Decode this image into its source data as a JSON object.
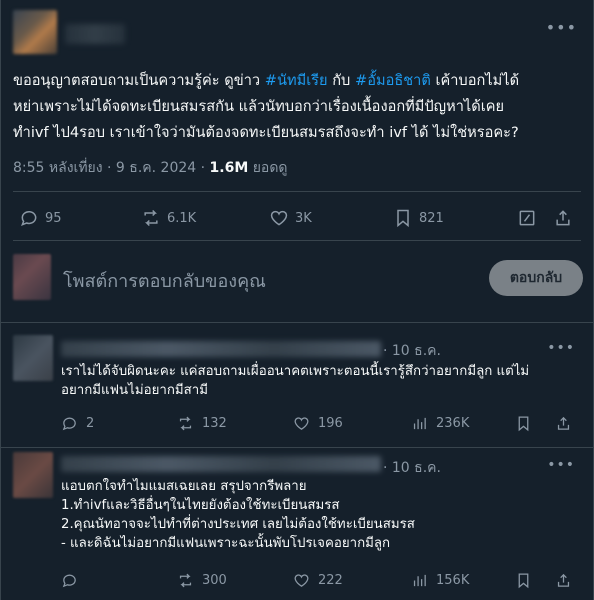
{
  "main_post": {
    "text_lines": [
      [
        "ขออนุญาตสอบถามเป็นความรู้ค่ะ ดูข่าว ",
        "#นัทมีเรีย",
        " กับ ",
        "#อั้มอธิชาติ",
        " เค้าบอกไม่ได้"
      ],
      [
        "หย่าเพราะไม่ได้จดทะเบียนสมรสกัน แล้วนัทบอกว่าเรื่องเนื้องอกที่มีปัญหาได้เคย"
      ],
      [
        "ทำivf ไป4รอบ เราเข้าใจว่ามันต้องจดทะเบียนสมรสถึงจะทำ ivf ได้ ไม่ใช่หรอคะ?"
      ]
    ],
    "time": "8:55 หลังเที่ยง · 9 ธ.ค. 2024 · ",
    "views": "1.6M",
    "views_label": " ยอดดู",
    "stats": {
      "replies": "95",
      "reposts": "6.1K",
      "likes": "3K",
      "bookmarks": "821"
    },
    "accent_color": "#1d9bf0"
  },
  "composer": {
    "placeholder": "โพสต์การตอบกลับของคุณ",
    "reply_button": "ตอบกลับ"
  },
  "replies": [
    {
      "date": "· 10 ธ.ค.",
      "text_lines": [
        "เราไม่ได้จับผิดนะคะ แค่สอบถามเผื่ออนาคตเพราะตอนนี้เรารู้สึกว่าอยากมีลูก แต่ไม่",
        "อยากมีแฟนไม่อยากมีสามี"
      ],
      "stats": {
        "replies": "2",
        "reposts": "132",
        "likes": "196",
        "views": "236K"
      }
    },
    {
      "date": "· 10 ธ.ค.",
      "text_lines": [
        "แอบตกใจทำไมแมสเฉยเลย สรุปจากรีพลาย",
        "1.ทำivfและวิธีอื่นๆในไทยยังต้องใช้ทะเบียนสมรส",
        "2.คุณนัทอาจจะไปทำที่ต่างประเทศ เลยไม่ต้องใช้ทะเบียนสมรส",
        "- และดิฉันไม่อยากมีแฟนเพราะฉะนั้นพับโปรเจคอยากมีลูก"
      ],
      "stats": {
        "replies": "",
        "reposts": "300",
        "likes": "222",
        "views": "156K"
      }
    }
  ]
}
